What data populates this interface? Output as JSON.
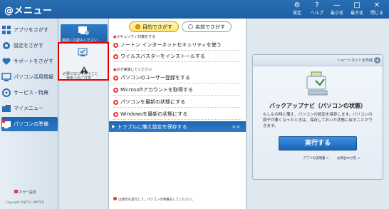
{
  "app": {
    "title": "@メニュー"
  },
  "toolbar": [
    {
      "icon": "gear-icon",
      "label": "設定"
    },
    {
      "icon": "question-icon",
      "label": "ヘルプ"
    },
    {
      "icon": "minimize-icon",
      "label": "最小化"
    },
    {
      "icon": "maximize-icon",
      "label": "最大化"
    },
    {
      "icon": "close-icon",
      "label": "閉じる"
    }
  ],
  "sidebar": {
    "items": [
      {
        "label": "アプリをさがす",
        "icon": "apps-icon"
      },
      {
        "label": "設定をさがす",
        "icon": "settings-icon"
      },
      {
        "label": "サポートをさがす",
        "icon": "heart-icon"
      },
      {
        "label": "パソコン活用情報",
        "icon": "monitor-icon"
      },
      {
        "label": "サービス・特典",
        "icon": "services-icon"
      },
      {
        "label": "マイメニュー",
        "icon": "folder-icon"
      },
      {
        "label": "パソコンの準備",
        "icon": "pc-setup-icon"
      }
    ],
    "active_index": 6,
    "footer": "カラー設定",
    "copyright": "Copyright FUJITSU LIMITED"
  },
  "col2": {
    "top_label": "最初にお読みください",
    "highlight_label": "必要に応じて行うこと",
    "caution_label": "使用上のご注意"
  },
  "main": {
    "tabs": [
      {
        "label": "目的でさがす",
        "active": true
      },
      {
        "label": "名前でさがす",
        "active": false
      }
    ],
    "section1": "セキュリティ対策をする",
    "section2": "必ず実施してください",
    "tasks": [
      "ノートン インターネットセキュリティを使う",
      "ウイルスバスターをインストールする",
      "パソコンのユーザー登録をする",
      "Microsoftアカウントを取得する",
      "パソコンを最新の状態にする",
      "Windowsを最新の状態にする",
      "トラブルに備え設定を保存する"
    ],
    "selected_task": 6,
    "bottom_note": "は間印を実行して、パソコンの準備をしてください。"
  },
  "panel": {
    "shortcut_label": "ショートカットを作成",
    "title": "バックアップナビ（パソコンの状態）",
    "description": "もしもの時に備え、パソコンの設定を保存します。パソコンの調子が悪くなったときは、保存しておいた状態に戻すことができます。",
    "run_label": "実行する",
    "links": [
      "アプリの説明書 >",
      "お問合わせ先 >"
    ]
  },
  "colors": {
    "titlebar": "#1d5ea3",
    "accent": "#2c7ccb",
    "highlight_frame": "#e10000"
  }
}
